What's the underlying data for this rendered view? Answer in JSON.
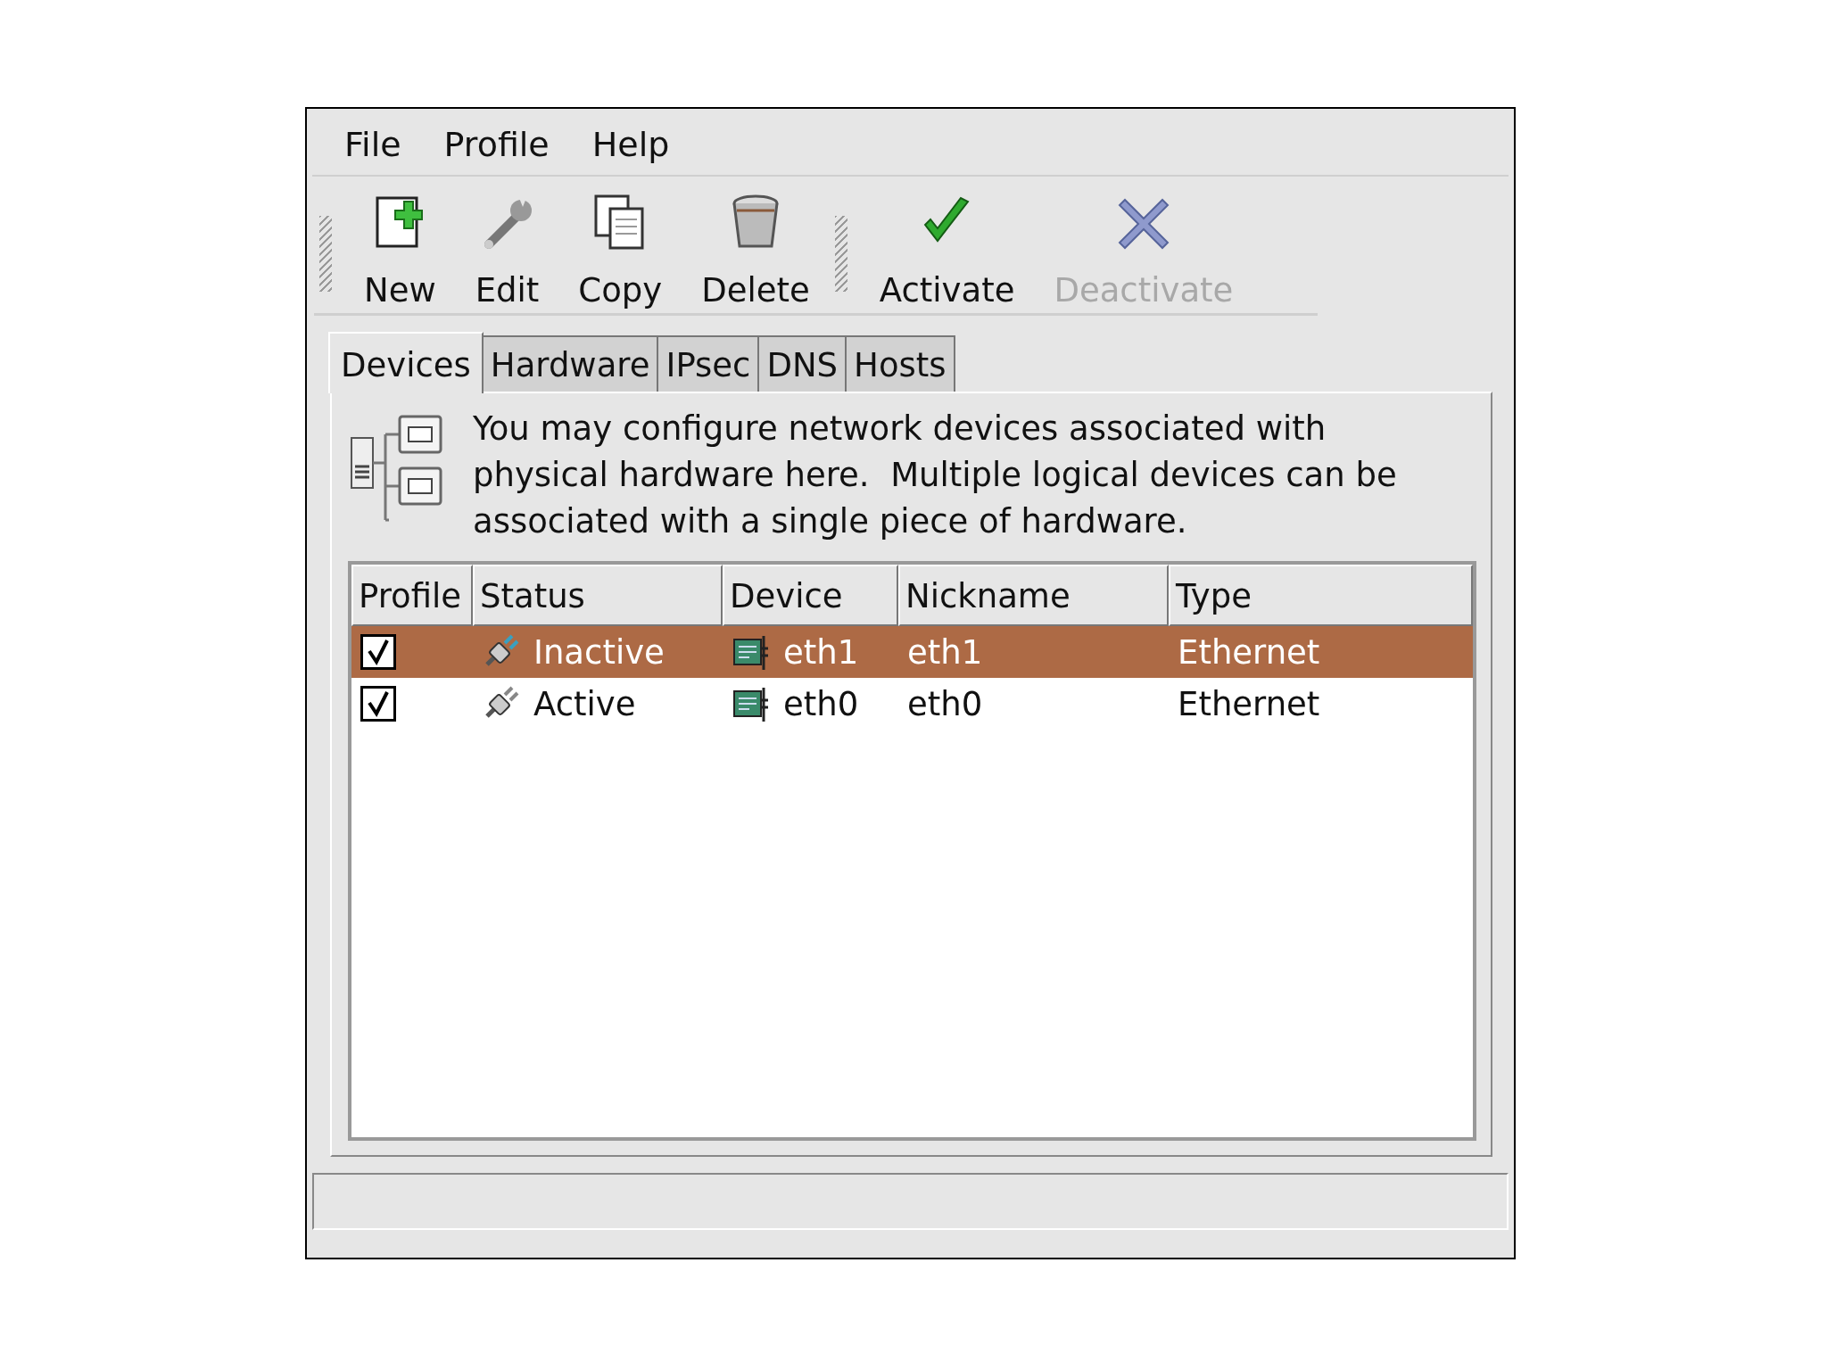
{
  "menu": [
    {
      "label": "File"
    },
    {
      "label": "Profile"
    },
    {
      "label": "Help"
    }
  ],
  "toolbar": [
    {
      "kind": "new",
      "label": "New",
      "disabled": false
    },
    {
      "kind": "edit",
      "label": "Edit",
      "disabled": false
    },
    {
      "kind": "copy",
      "label": "Copy",
      "disabled": false
    },
    {
      "kind": "delete",
      "label": "Delete",
      "disabled": false
    },
    {
      "kind": "separator"
    },
    {
      "kind": "activate",
      "label": "Activate",
      "disabled": false
    },
    {
      "kind": "deactivate",
      "label": "Deactivate",
      "disabled": true
    }
  ],
  "tabs": [
    {
      "label": "Devices",
      "selected": true
    },
    {
      "label": "Hardware",
      "selected": false
    },
    {
      "label": "IPsec",
      "selected": false
    },
    {
      "label": "DNS",
      "selected": false
    },
    {
      "label": "Hosts",
      "selected": false
    }
  ],
  "description": "You may configure network devices associated with physical hardware here.  Multiple logical devices can be associated with a single piece of hardware.",
  "table": {
    "columns": [
      "Profile",
      "Status",
      "Device",
      "Nickname",
      "Type"
    ],
    "rows": [
      {
        "checked": true,
        "selected": true,
        "status": "Inactive",
        "active": false,
        "device": "eth1",
        "nickname": "eth1",
        "type": "Ethernet"
      },
      {
        "checked": true,
        "selected": false,
        "status": "Active",
        "active": true,
        "device": "eth0",
        "nickname": "eth0",
        "type": "Ethernet"
      }
    ]
  }
}
